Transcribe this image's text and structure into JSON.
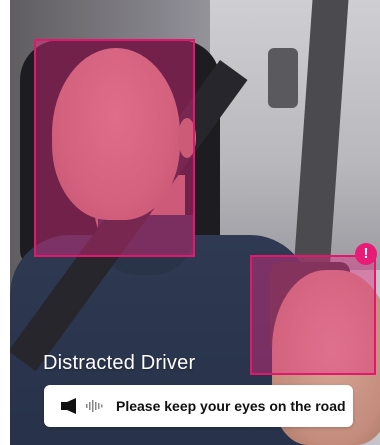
{
  "detection": {
    "status_label": "Distracted Driver",
    "alert_badge": "!",
    "warning_message": "Please keep your eyes on the road",
    "icons": {
      "speaker": "speaker-icon",
      "sound_wave": "sound-wave-icon",
      "alert": "exclamation-icon"
    },
    "colors": {
      "highlight": "#e2186f",
      "badge": "#e81b76",
      "card_background": "#ffffff",
      "card_text": "#111111"
    }
  }
}
